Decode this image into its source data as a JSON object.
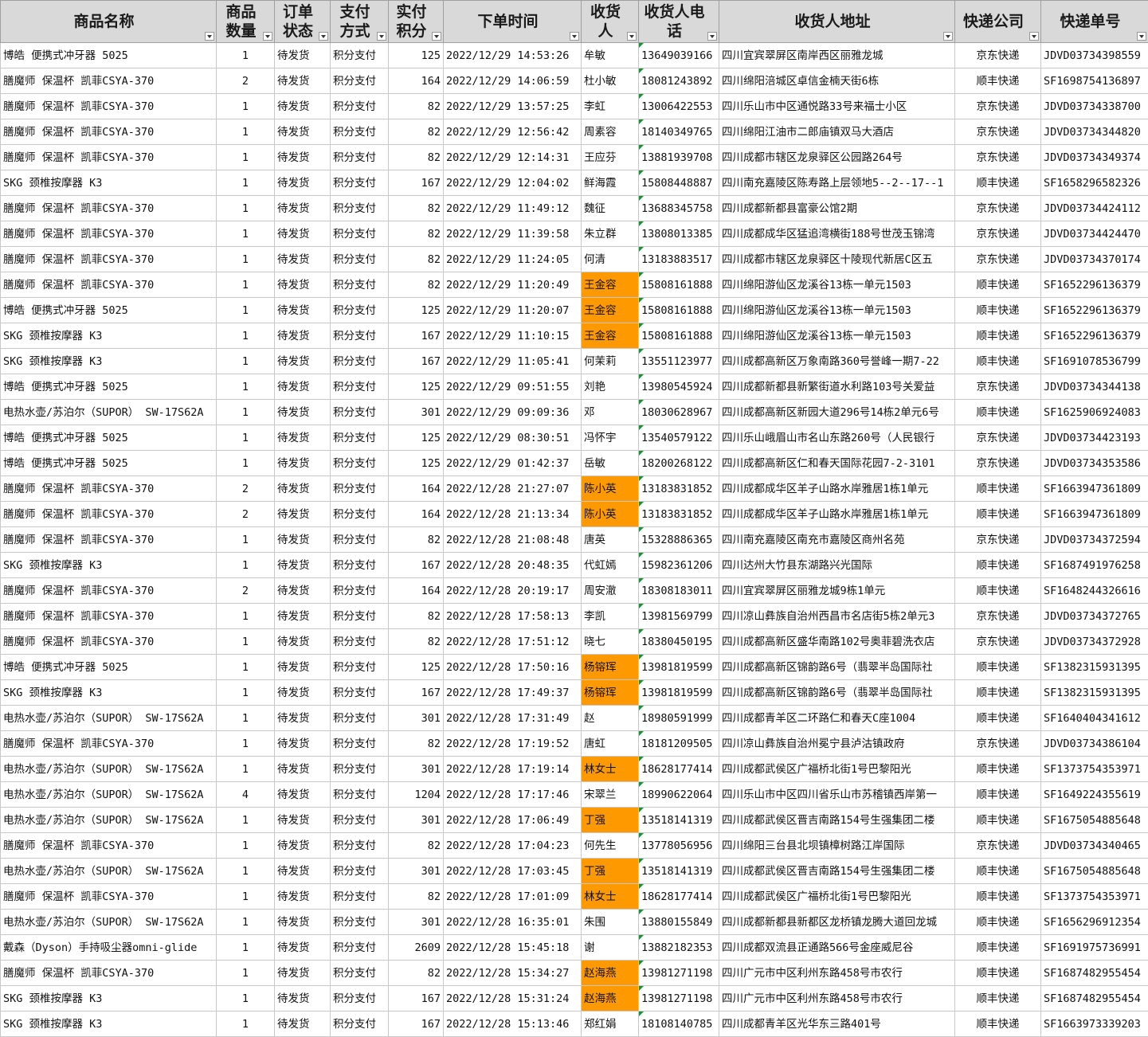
{
  "columns": [
    {
      "key": "product",
      "label": "商品名称",
      "align": "left",
      "width": 271
    },
    {
      "key": "qty",
      "label": "商品数量",
      "align": "center",
      "width": 73
    },
    {
      "key": "status",
      "label": "订单状态",
      "align": "left",
      "width": 70
    },
    {
      "key": "pay",
      "label": "支付方式",
      "align": "left",
      "width": 73
    },
    {
      "key": "points",
      "label": "实付积分",
      "align": "right",
      "width": 69
    },
    {
      "key": "time",
      "label": "下单时间",
      "align": "left",
      "width": 173
    },
    {
      "key": "name",
      "label": "收货人",
      "align": "left",
      "width": 72
    },
    {
      "key": "phone",
      "label": "收货人电话",
      "align": "left",
      "width": 101
    },
    {
      "key": "address",
      "label": "收货人地址",
      "align": "left",
      "width": 296
    },
    {
      "key": "courier",
      "label": "快递公司",
      "align": "center",
      "width": 108
    },
    {
      "key": "tracking",
      "label": "快递单号",
      "align": "left",
      "width": 135
    }
  ],
  "colors": {
    "highlight": "#ff9900",
    "header": "#d9d9d9",
    "error_marker": "#1d8f3a"
  },
  "rows": [
    {
      "product": "博皓 便携式冲牙器 5025",
      "qty": "1",
      "status": "待发货",
      "pay": "积分支付",
      "points": "125",
      "time": "2022/12/29 14:53:26",
      "name": "牟敏",
      "phone": "13649039166",
      "address": "四川宜宾翠屏区南岸西区丽雅龙城",
      "courier": "京东快递",
      "tracking": "JDVD03734398559",
      "hl": false
    },
    {
      "product": "膳魔师 保温杯 凯菲CSYA-370",
      "qty": "2",
      "status": "待发货",
      "pay": "积分支付",
      "points": "164",
      "time": "2022/12/29 14:06:59",
      "name": "杜小敏",
      "phone": "18081243892",
      "address": "四川绵阳涪城区卓信金楠天街6栋",
      "courier": "顺丰快递",
      "tracking": "SF1698754136897",
      "hl": false
    },
    {
      "product": "膳魔师 保温杯 凯菲CSYA-370",
      "qty": "1",
      "status": "待发货",
      "pay": "积分支付",
      "points": "82",
      "time": "2022/12/29 13:57:25",
      "name": "李虹",
      "phone": "13006422553",
      "address": "四川乐山市中区通悦路33号来福士小区",
      "courier": "京东快递",
      "tracking": "JDVD03734338700",
      "hl": false
    },
    {
      "product": "膳魔师 保温杯 凯菲CSYA-370",
      "qty": "1",
      "status": "待发货",
      "pay": "积分支付",
      "points": "82",
      "time": "2022/12/29 12:56:42",
      "name": "周素容",
      "phone": "18140349765",
      "address": "四川绵阳江油市二郎庙镇双马大酒店",
      "courier": "京东快递",
      "tracking": "JDVD03734344820",
      "hl": false
    },
    {
      "product": "膳魔师 保温杯 凯菲CSYA-370",
      "qty": "1",
      "status": "待发货",
      "pay": "积分支付",
      "points": "82",
      "time": "2022/12/29 12:14:31",
      "name": "王应芬",
      "phone": "13881939708",
      "address": "四川成都市辖区龙泉驿区公园路264号",
      "courier": "京东快递",
      "tracking": "JDVD03734349374",
      "hl": false
    },
    {
      "product": "SKG 颈椎按摩器 K3",
      "qty": "1",
      "status": "待发货",
      "pay": "积分支付",
      "points": "167",
      "time": "2022/12/29 12:04:02",
      "name": "鲜海霞",
      "phone": "15808448887",
      "address": "四川南充嘉陵区陈寿路上层领地5--2--17--1",
      "courier": "顺丰快递",
      "tracking": "SF1658296582326",
      "hl": false
    },
    {
      "product": "膳魔师 保温杯 凯菲CSYA-370",
      "qty": "1",
      "status": "待发货",
      "pay": "积分支付",
      "points": "82",
      "time": "2022/12/29 11:49:12",
      "name": "魏征",
      "phone": "13688345758",
      "address": "四川成都新都县富豪公馆2期",
      "courier": "京东快递",
      "tracking": "JDVD03734424112",
      "hl": false
    },
    {
      "product": "膳魔师 保温杯 凯菲CSYA-370",
      "qty": "1",
      "status": "待发货",
      "pay": "积分支付",
      "points": "82",
      "time": "2022/12/29 11:39:58",
      "name": "朱立群",
      "phone": "13808013385",
      "address": "四川成都成华区猛追湾横街188号世茂玉锦湾",
      "courier": "京东快递",
      "tracking": "JDVD03734424470",
      "hl": false
    },
    {
      "product": "膳魔师 保温杯 凯菲CSYA-370",
      "qty": "1",
      "status": "待发货",
      "pay": "积分支付",
      "points": "82",
      "time": "2022/12/29 11:24:05",
      "name": "何清",
      "phone": "13183883517",
      "address": "四川成都市辖区龙泉驿区十陵现代新居C区五",
      "courier": "京东快递",
      "tracking": "JDVD03734370174",
      "hl": false
    },
    {
      "product": "膳魔师 保温杯 凯菲CSYA-370",
      "qty": "1",
      "status": "待发货",
      "pay": "积分支付",
      "points": "82",
      "time": "2022/12/29 11:20:49",
      "name": "王金容",
      "phone": "15808161888",
      "address": "四川绵阳游仙区龙溪谷13栋一单元1503",
      "courier": "顺丰快递",
      "tracking": "SF1652296136379",
      "hl": true
    },
    {
      "product": "博皓 便携式冲牙器 5025",
      "qty": "1",
      "status": "待发货",
      "pay": "积分支付",
      "points": "125",
      "time": "2022/12/29 11:20:07",
      "name": "王金容",
      "phone": "15808161888",
      "address": "四川绵阳游仙区龙溪谷13栋一单元1503",
      "courier": "顺丰快递",
      "tracking": "SF1652296136379",
      "hl": true
    },
    {
      "product": "SKG 颈椎按摩器 K3",
      "qty": "1",
      "status": "待发货",
      "pay": "积分支付",
      "points": "167",
      "time": "2022/12/29 11:10:15",
      "name": "王金容",
      "phone": "15808161888",
      "address": "四川绵阳游仙区龙溪谷13栋一单元1503",
      "courier": "顺丰快递",
      "tracking": "SF1652296136379",
      "hl": true
    },
    {
      "product": "SKG 颈椎按摩器 K3",
      "qty": "1",
      "status": "待发货",
      "pay": "积分支付",
      "points": "167",
      "time": "2022/12/29 11:05:41",
      "name": "何茉莉",
      "phone": "13551123977",
      "address": "四川成都高新区万象南路360号誉峰一期7-22",
      "courier": "顺丰快递",
      "tracking": "SF1691078536799",
      "hl": false
    },
    {
      "product": "博皓 便携式冲牙器 5025",
      "qty": "1",
      "status": "待发货",
      "pay": "积分支付",
      "points": "125",
      "time": "2022/12/29 09:51:55",
      "name": "刘艳",
      "phone": "13980545924",
      "address": "四川成都新都县新繁街道水利路103号关爱益",
      "courier": "京东快递",
      "tracking": "JDVD03734344138",
      "hl": false
    },
    {
      "product": "电热水壶/苏泊尔（SUPOR） SW-17S62A",
      "qty": "1",
      "status": "待发货",
      "pay": "积分支付",
      "points": "301",
      "time": "2022/12/29 09:09:36",
      "name": "邓",
      "phone": "18030628967",
      "address": "四川成都高新区新园大道296号14栋2单元6号",
      "courier": "顺丰快递",
      "tracking": "SF1625906924083",
      "hl": false
    },
    {
      "product": "博皓 便携式冲牙器 5025",
      "qty": "1",
      "status": "待发货",
      "pay": "积分支付",
      "points": "125",
      "time": "2022/12/29 08:30:51",
      "name": "冯怀宇",
      "phone": "13540579122",
      "address": "四川乐山峨眉山市名山东路260号（人民银行",
      "courier": "京东快递",
      "tracking": "JDVD03734423193",
      "hl": false
    },
    {
      "product": "博皓 便携式冲牙器 5025",
      "qty": "1",
      "status": "待发货",
      "pay": "积分支付",
      "points": "125",
      "time": "2022/12/29 01:42:37",
      "name": "岳敏",
      "phone": "18200268122",
      "address": "四川成都高新区仁和春天国际花园7-2-3101",
      "courier": "京东快递",
      "tracking": "JDVD03734353586",
      "hl": false
    },
    {
      "product": "膳魔师 保温杯 凯菲CSYA-370",
      "qty": "2",
      "status": "待发货",
      "pay": "积分支付",
      "points": "164",
      "time": "2022/12/28 21:27:07",
      "name": "陈小英",
      "phone": "13183831852",
      "address": "四川成都成华区羊子山路水岸雅居1栋1单元",
      "courier": "顺丰快递",
      "tracking": "SF1663947361809",
      "hl": true
    },
    {
      "product": "膳魔师 保温杯 凯菲CSYA-370",
      "qty": "2",
      "status": "待发货",
      "pay": "积分支付",
      "points": "164",
      "time": "2022/12/28 21:13:34",
      "name": "陈小英",
      "phone": "13183831852",
      "address": "四川成都成华区羊子山路水岸雅居1栋1单元",
      "courier": "顺丰快递",
      "tracking": "SF1663947361809",
      "hl": true
    },
    {
      "product": "膳魔师 保温杯 凯菲CSYA-370",
      "qty": "1",
      "status": "待发货",
      "pay": "积分支付",
      "points": "82",
      "time": "2022/12/28 21:08:48",
      "name": "唐英",
      "phone": "15328886365",
      "address": "四川南充嘉陵区南充市嘉陵区商州名苑",
      "courier": "京东快递",
      "tracking": "JDVD03734372594",
      "hl": false
    },
    {
      "product": "SKG 颈椎按摩器 K3",
      "qty": "1",
      "status": "待发货",
      "pay": "积分支付",
      "points": "167",
      "time": "2022/12/28 20:48:35",
      "name": "代虹嫣",
      "phone": "15982361206",
      "address": "四川达州大竹县东湖路兴光国际",
      "courier": "顺丰快递",
      "tracking": "SF1687491976258",
      "hl": false
    },
    {
      "product": "膳魔师 保温杯 凯菲CSYA-370",
      "qty": "2",
      "status": "待发货",
      "pay": "积分支付",
      "points": "164",
      "time": "2022/12/28 20:19:17",
      "name": "周安澈",
      "phone": "18308183011",
      "address": "四川宜宾翠屏区丽雅龙城9栋1单元",
      "courier": "顺丰快递",
      "tracking": "SF1648244326616",
      "hl": false
    },
    {
      "product": "膳魔师 保温杯 凯菲CSYA-370",
      "qty": "1",
      "status": "待发货",
      "pay": "积分支付",
      "points": "82",
      "time": "2022/12/28 17:58:13",
      "name": "李凯",
      "phone": "13981569799",
      "address": "四川凉山彝族自治州西昌市名店街5栋2单元3",
      "courier": "京东快递",
      "tracking": "JDVD03734372765",
      "hl": false
    },
    {
      "product": "膳魔师 保温杯 凯菲CSYA-370",
      "qty": "1",
      "status": "待发货",
      "pay": "积分支付",
      "points": "82",
      "time": "2022/12/28 17:51:12",
      "name": "晓七",
      "phone": "18380450195",
      "address": "四川成都高新区盛华南路102号奥菲碧洗衣店",
      "courier": "京东快递",
      "tracking": "JDVD03734372928",
      "hl": false
    },
    {
      "product": "博皓 便携式冲牙器 5025",
      "qty": "1",
      "status": "待发货",
      "pay": "积分支付",
      "points": "125",
      "time": "2022/12/28 17:50:16",
      "name": "杨镕珲",
      "phone": "13981819599",
      "address": "四川成都高新区锦韵路6号（翡翠半岛国际社",
      "courier": "顺丰快递",
      "tracking": "SF1382315931395",
      "hl": true
    },
    {
      "product": "SKG 颈椎按摩器 K3",
      "qty": "1",
      "status": "待发货",
      "pay": "积分支付",
      "points": "167",
      "time": "2022/12/28 17:49:37",
      "name": "杨镕珲",
      "phone": "13981819599",
      "address": "四川成都高新区锦韵路6号（翡翠半岛国际社",
      "courier": "顺丰快递",
      "tracking": "SF1382315931395",
      "hl": true
    },
    {
      "product": "电热水壶/苏泊尔（SUPOR） SW-17S62A",
      "qty": "1",
      "status": "待发货",
      "pay": "积分支付",
      "points": "301",
      "time": "2022/12/28 17:31:49",
      "name": "赵",
      "phone": "18980591999",
      "address": "四川成都青羊区二环路仁和春天C座1004",
      "courier": "顺丰快递",
      "tracking": "SF1640404341612",
      "hl": false
    },
    {
      "product": "膳魔师 保温杯 凯菲CSYA-370",
      "qty": "1",
      "status": "待发货",
      "pay": "积分支付",
      "points": "82",
      "time": "2022/12/28 17:19:52",
      "name": "唐虹",
      "phone": "18181209505",
      "address": "四川凉山彝族自治州冕宁县泸沽镇政府",
      "courier": "京东快递",
      "tracking": "JDVD03734386104",
      "hl": false
    },
    {
      "product": "电热水壶/苏泊尔（SUPOR） SW-17S62A",
      "qty": "1",
      "status": "待发货",
      "pay": "积分支付",
      "points": "301",
      "time": "2022/12/28 17:19:14",
      "name": "林女士",
      "phone": "18628177414",
      "address": "四川成都武侯区广福桥北街1号巴黎阳光",
      "courier": "顺丰快递",
      "tracking": "SF1373754353971",
      "hl": true
    },
    {
      "product": "电热水壶/苏泊尔（SUPOR） SW-17S62A",
      "qty": "4",
      "status": "待发货",
      "pay": "积分支付",
      "points": "1204",
      "time": "2022/12/28 17:17:46",
      "name": "宋翠兰",
      "phone": "18990622064",
      "address": "四川乐山市中区四川省乐山市苏稽镇西岸第一",
      "courier": "顺丰快递",
      "tracking": "SF1649224355619",
      "hl": false
    },
    {
      "product": "电热水壶/苏泊尔（SUPOR） SW-17S62A",
      "qty": "1",
      "status": "待发货",
      "pay": "积分支付",
      "points": "301",
      "time": "2022/12/28 17:06:49",
      "name": "丁强",
      "phone": "13518141319",
      "address": "四川成都武侯区晋吉南路154号生强集团二楼",
      "courier": "顺丰快递",
      "tracking": "SF1675054885648",
      "hl": true
    },
    {
      "product": "膳魔师 保温杯 凯菲CSYA-370",
      "qty": "1",
      "status": "待发货",
      "pay": "积分支付",
      "points": "82",
      "time": "2022/12/28 17:04:23",
      "name": "何先生",
      "phone": "13778056956",
      "address": "四川绵阳三台县北坝镇樟树路江岸国际",
      "courier": "京东快递",
      "tracking": "JDVD03734340465",
      "hl": false
    },
    {
      "product": "电热水壶/苏泊尔（SUPOR） SW-17S62A",
      "qty": "1",
      "status": "待发货",
      "pay": "积分支付",
      "points": "301",
      "time": "2022/12/28 17:03:45",
      "name": "丁强",
      "phone": "13518141319",
      "address": "四川成都武侯区晋吉南路154号生强集团二楼",
      "courier": "顺丰快递",
      "tracking": "SF1675054885648",
      "hl": true
    },
    {
      "product": "膳魔师 保温杯 凯菲CSYA-370",
      "qty": "1",
      "status": "待发货",
      "pay": "积分支付",
      "points": "82",
      "time": "2022/12/28 17:01:09",
      "name": "林女士",
      "phone": "18628177414",
      "address": "四川成都武侯区广福桥北街1号巴黎阳光",
      "courier": "顺丰快递",
      "tracking": "SF1373754353971",
      "hl": true
    },
    {
      "product": "电热水壶/苏泊尔（SUPOR） SW-17S62A",
      "qty": "1",
      "status": "待发货",
      "pay": "积分支付",
      "points": "301",
      "time": "2022/12/28 16:35:01",
      "name": "朱围",
      "phone": "13880155849",
      "address": "四川成都新都县新都区龙桥镇龙腾大道回龙城",
      "courier": "顺丰快递",
      "tracking": "SF1656296912354",
      "hl": false
    },
    {
      "product": "戴森（Dyson）手持吸尘器omni-glide",
      "qty": "1",
      "status": "待发货",
      "pay": "积分支付",
      "points": "2609",
      "time": "2022/12/28 15:45:18",
      "name": "谢",
      "phone": "13882182353",
      "address": "四川成都双流县正通路566号金座威尼谷",
      "courier": "顺丰快递",
      "tracking": "SF1691975736991",
      "hl": false
    },
    {
      "product": "膳魔师 保温杯 凯菲CSYA-370",
      "qty": "1",
      "status": "待发货",
      "pay": "积分支付",
      "points": "82",
      "time": "2022/12/28 15:34:27",
      "name": "赵海燕",
      "phone": "13981271198",
      "address": "四川广元市中区利州东路458号市农行",
      "courier": "顺丰快递",
      "tracking": "SF1687482955454",
      "hl": true
    },
    {
      "product": "SKG 颈椎按摩器 K3",
      "qty": "1",
      "status": "待发货",
      "pay": "积分支付",
      "points": "167",
      "time": "2022/12/28 15:31:24",
      "name": "赵海燕",
      "phone": "13981271198",
      "address": "四川广元市中区利州东路458号市农行",
      "courier": "顺丰快递",
      "tracking": "SF1687482955454",
      "hl": true
    },
    {
      "product": "SKG 颈椎按摩器 K3",
      "qty": "1",
      "status": "待发货",
      "pay": "积分支付",
      "points": "167",
      "time": "2022/12/28 15:13:46",
      "name": "郑红娟",
      "phone": "18108140785",
      "address": "四川成都青羊区光华东三路401号",
      "courier": "顺丰快递",
      "tracking": "SF1663973339203",
      "hl": false
    }
  ]
}
